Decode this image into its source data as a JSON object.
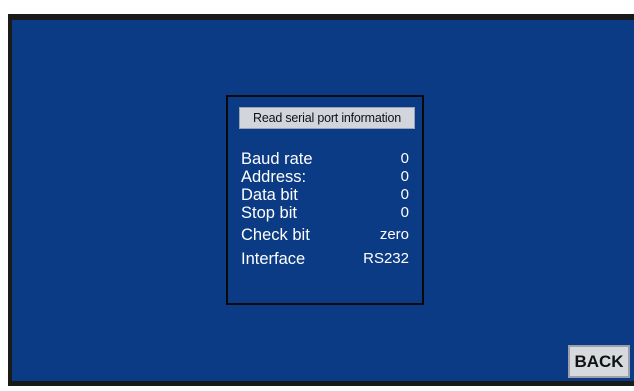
{
  "panel": {
    "title": "Read serial port information",
    "rows": [
      {
        "label": "Baud rate",
        "value": "0"
      },
      {
        "label": "Address:",
        "value": "0"
      },
      {
        "label": "Data bit",
        "value": "0"
      },
      {
        "label": "Stop bit",
        "value": "0"
      },
      {
        "label": "Check bit",
        "value": "zero"
      },
      {
        "label": "Interface",
        "value": "RS232"
      }
    ]
  },
  "back_button": {
    "label": "BACK"
  },
  "colors": {
    "screen_background": "#0b3b84",
    "panel_border": "#0a0a0a",
    "title_background": "#d2d6dc",
    "button_background": "#d6d9de",
    "text": "#ffffff"
  }
}
